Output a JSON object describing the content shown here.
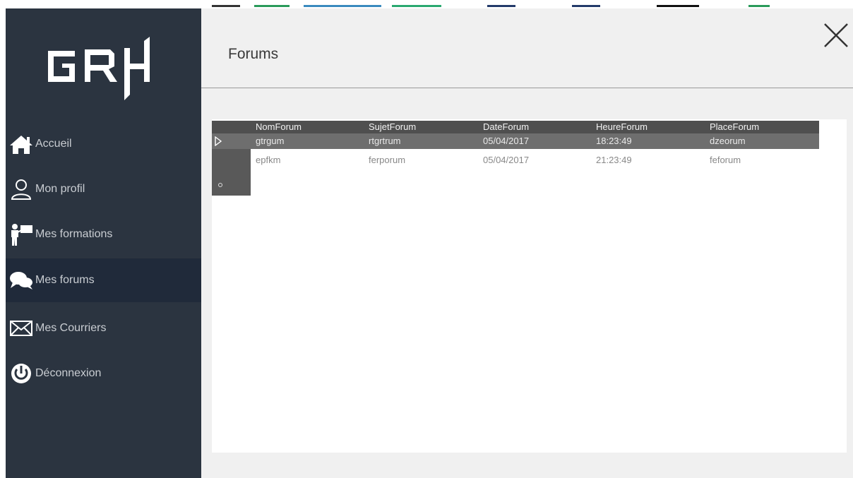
{
  "app": {
    "logo_text": "GRH",
    "page_title": "Forums"
  },
  "sidebar": {
    "items": [
      {
        "label": "Accueil",
        "icon": "home-icon"
      },
      {
        "label": "Mon profil",
        "icon": "user-icon"
      },
      {
        "label": "Mes formations",
        "icon": "teacher-icon"
      },
      {
        "label": "Mes forums",
        "icon": "chat-bubbles-icon",
        "active": true
      },
      {
        "label": "Mes Courriers",
        "icon": "envelope-icon"
      },
      {
        "label": "Déconnexion",
        "icon": "power-icon"
      }
    ]
  },
  "grid": {
    "columns": [
      "NomForum",
      "SujetForum",
      "DateForum",
      "HeureForum",
      "PlaceForum"
    ],
    "rows": [
      [
        "gtrgum",
        "rtgrtrum",
        "05/04/2017",
        "18:23:49",
        "dzeorum"
      ],
      [
        "epfkm",
        "ferporum",
        "05/04/2017",
        "21:23:49",
        "feforum"
      ]
    ],
    "selected_row": 0
  },
  "colors": {
    "sidebar_bg": "#2b3440",
    "sidebar_active_bg": "#202a3a",
    "main_bg": "#f0f0f0",
    "grid_header_bg": "#4f4f4f",
    "selected_row_bg": "#6e6e6e"
  }
}
